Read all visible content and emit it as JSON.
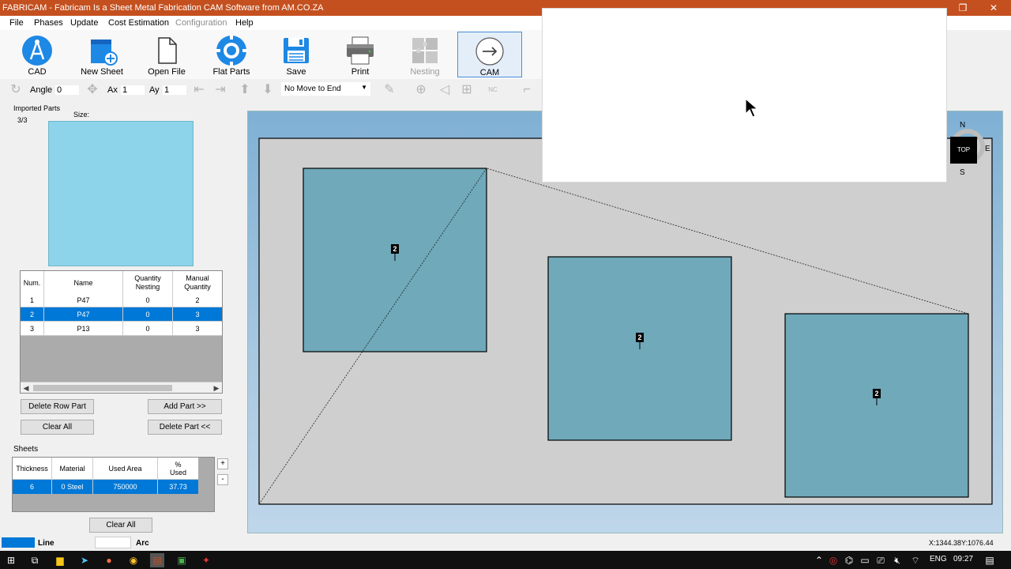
{
  "window": {
    "title": "FABRICAM - Fabricam Is a Sheet Metal Fabrication CAM Software from AM.CO.ZA",
    "minimize": "—",
    "maximize": "❐",
    "close": "✕"
  },
  "menu": {
    "file": "File",
    "phases": "Phases",
    "update": "Update",
    "cost_estimation": "Cost Estimation",
    "configuration": "Configuration",
    "help": "Help"
  },
  "ribbon": {
    "cad": "CAD",
    "new_sheet": "New Sheet",
    "open_file": "Open File",
    "flat_parts": "Flat Parts",
    "save": "Save",
    "print": "Print",
    "nesting": "Nesting",
    "cam": "CAM"
  },
  "toolbar": {
    "angle_label": "Angle",
    "angle_value": "0",
    "ax_label": "Ax",
    "ax_value": "1",
    "ay_label": "Ay",
    "ay_value": "1",
    "move_option": "No Move to End"
  },
  "left_panel": {
    "imported_parts_label": "Imported Parts",
    "count": "3/3",
    "size_label": "Size:",
    "parts_table": {
      "headers": {
        "num": "Num.",
        "name": "Name",
        "qty_nesting_1": "Quantity",
        "qty_nesting_2": "Nesting",
        "manual_qty_1": "Manual",
        "manual_qty_2": "Quantity"
      },
      "rows": [
        {
          "num": "1",
          "name": "P47",
          "nesting": "0",
          "manual": "2"
        },
        {
          "num": "2",
          "name": "P47",
          "nesting": "0",
          "manual": "3"
        },
        {
          "num": "3",
          "name": "P13",
          "nesting": "0",
          "manual": "3"
        }
      ],
      "selected_row": 2
    },
    "buttons": {
      "delete_row_part": "Delete Row Part",
      "add_part": "Add Part >>",
      "clear_all": "Clear All",
      "delete_part": "Delete Part <<"
    },
    "sheets_label": "Sheets",
    "sheets_table": {
      "headers": {
        "thickness": "Thickness",
        "material": "Material",
        "used_area": "Used Area",
        "pct_1": "%",
        "pct_2": "Used"
      },
      "row": {
        "thickness": "6",
        "material": "0 Steel",
        "used_area": "750000",
        "pct": "37.73"
      }
    },
    "sheets_plus": "+",
    "sheets_minus": "-",
    "sheets_clear_all": "Clear All"
  },
  "canvas": {
    "part_labels": [
      "2",
      "2",
      "2"
    ],
    "nav": {
      "top": "TOP",
      "n": "N",
      "s": "S",
      "e": "E"
    }
  },
  "status": {
    "line": "Line",
    "arc": "Arc",
    "coords": "X:1344.38Y:1076.44"
  },
  "taskbar": {
    "language": "ENG",
    "time": "09:27"
  }
}
